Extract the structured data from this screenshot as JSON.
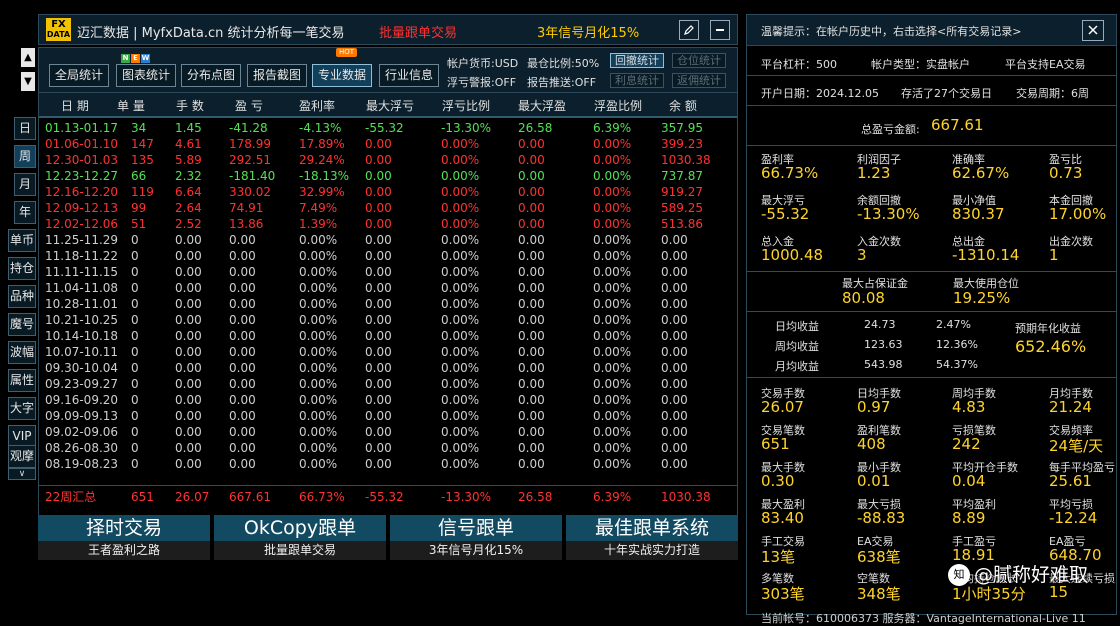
{
  "header": {
    "logo_top": "FX",
    "logo_bottom": "DATA",
    "brand": "迈汇数据 | MyfxData.cn  统计分析每一笔交易",
    "promo_left": "批量跟单交易",
    "promo_right": "3年信号月化15%",
    "edit_icon": "pencil-icon",
    "minimize_icon": "minimize-icon"
  },
  "toolbar": {
    "buttons": [
      "全局统计",
      "图表统计",
      "分布点图",
      "报告截图",
      "专业数据",
      "行业信息"
    ],
    "new_badge": [
      "N",
      "E",
      "W"
    ],
    "hot_badge": "HOT",
    "currency": "帐户货币:USD",
    "max_position": "最仓比例:50%",
    "loss_alert": "浮亏警报:OFF",
    "report_push": "报告推送:OFF",
    "small_buttons": [
      "回撤统计",
      "仓位统计",
      "利息统计",
      "返佣统计"
    ]
  },
  "side": {
    "arrows": [
      "▲",
      "▼"
    ],
    "period_buttons": [
      "日",
      "周",
      "月",
      "年"
    ],
    "tool_buttons": [
      "单币",
      "持仓",
      "品种",
      "魔号",
      "波幅",
      "属性",
      "大字",
      "VIP",
      "观摩"
    ],
    "collapse": "∨"
  },
  "table": {
    "headers": [
      "日 期",
      "单 量",
      "手 数",
      "盈 亏",
      "盈利率",
      "最大浮亏",
      "浮亏比例",
      "最大浮盈",
      "浮盈比例",
      "余 额"
    ],
    "rows": [
      {
        "cls": "green",
        "cells": [
          "01.13-01.17",
          "34",
          "1.45",
          "-41.28",
          "-4.13%",
          "-55.32",
          "-13.30%",
          "26.58",
          "6.39%",
          "357.95"
        ]
      },
      {
        "cls": "red",
        "cells": [
          "01.06-01.10",
          "147",
          "4.61",
          "178.99",
          "17.89%",
          "0.00",
          "0.00%",
          "0.00",
          "0.00%",
          "399.23"
        ]
      },
      {
        "cls": "red",
        "cells": [
          "12.30-01.03",
          "135",
          "5.89",
          "292.51",
          "29.24%",
          "0.00",
          "0.00%",
          "0.00",
          "0.00%",
          "1030.38"
        ]
      },
      {
        "cls": "green",
        "cells": [
          "12.23-12.27",
          "66",
          "2.32",
          "-181.40",
          "-18.13%",
          "0.00",
          "0.00%",
          "0.00",
          "0.00%",
          "737.87"
        ]
      },
      {
        "cls": "red",
        "cells": [
          "12.16-12.20",
          "119",
          "6.64",
          "330.02",
          "32.99%",
          "0.00",
          "0.00%",
          "0.00",
          "0.00%",
          "919.27"
        ]
      },
      {
        "cls": "red",
        "cells": [
          "12.09-12.13",
          "99",
          "2.64",
          "74.91",
          "7.49%",
          "0.00",
          "0.00%",
          "0.00",
          "0.00%",
          "589.25"
        ]
      },
      {
        "cls": "red",
        "cells": [
          "12.02-12.06",
          "51",
          "2.52",
          "13.86",
          "1.39%",
          "0.00",
          "0.00%",
          "0.00",
          "0.00%",
          "513.86"
        ]
      },
      {
        "cls": "gray",
        "cells": [
          "11.25-11.29",
          "0",
          "0.00",
          "0.00",
          "0.00%",
          "0.00",
          "0.00%",
          "0.00",
          "0.00%",
          "0.00"
        ]
      },
      {
        "cls": "gray",
        "cells": [
          "11.18-11.22",
          "0",
          "0.00",
          "0.00",
          "0.00%",
          "0.00",
          "0.00%",
          "0.00",
          "0.00%",
          "0.00"
        ]
      },
      {
        "cls": "gray",
        "cells": [
          "11.11-11.15",
          "0",
          "0.00",
          "0.00",
          "0.00%",
          "0.00",
          "0.00%",
          "0.00",
          "0.00%",
          "0.00"
        ]
      },
      {
        "cls": "gray",
        "cells": [
          "11.04-11.08",
          "0",
          "0.00",
          "0.00",
          "0.00%",
          "0.00",
          "0.00%",
          "0.00",
          "0.00%",
          "0.00"
        ]
      },
      {
        "cls": "gray",
        "cells": [
          "10.28-11.01",
          "0",
          "0.00",
          "0.00",
          "0.00%",
          "0.00",
          "0.00%",
          "0.00",
          "0.00%",
          "0.00"
        ]
      },
      {
        "cls": "gray",
        "cells": [
          "10.21-10.25",
          "0",
          "0.00",
          "0.00",
          "0.00%",
          "0.00",
          "0.00%",
          "0.00",
          "0.00%",
          "0.00"
        ]
      },
      {
        "cls": "gray",
        "cells": [
          "10.14-10.18",
          "0",
          "0.00",
          "0.00",
          "0.00%",
          "0.00",
          "0.00%",
          "0.00",
          "0.00%",
          "0.00"
        ]
      },
      {
        "cls": "gray",
        "cells": [
          "10.07-10.11",
          "0",
          "0.00",
          "0.00",
          "0.00%",
          "0.00",
          "0.00%",
          "0.00",
          "0.00%",
          "0.00"
        ]
      },
      {
        "cls": "gray",
        "cells": [
          "09.30-10.04",
          "0",
          "0.00",
          "0.00",
          "0.00%",
          "0.00",
          "0.00%",
          "0.00",
          "0.00%",
          "0.00"
        ]
      },
      {
        "cls": "gray",
        "cells": [
          "09.23-09.27",
          "0",
          "0.00",
          "0.00",
          "0.00%",
          "0.00",
          "0.00%",
          "0.00",
          "0.00%",
          "0.00"
        ]
      },
      {
        "cls": "gray",
        "cells": [
          "09.16-09.20",
          "0",
          "0.00",
          "0.00",
          "0.00%",
          "0.00",
          "0.00%",
          "0.00",
          "0.00%",
          "0.00"
        ]
      },
      {
        "cls": "gray",
        "cells": [
          "09.09-09.13",
          "0",
          "0.00",
          "0.00",
          "0.00%",
          "0.00",
          "0.00%",
          "0.00",
          "0.00%",
          "0.00"
        ]
      },
      {
        "cls": "gray",
        "cells": [
          "09.02-09.06",
          "0",
          "0.00",
          "0.00",
          "0.00%",
          "0.00",
          "0.00%",
          "0.00",
          "0.00%",
          "0.00"
        ]
      },
      {
        "cls": "gray",
        "cells": [
          "08.26-08.30",
          "0",
          "0.00",
          "0.00",
          "0.00%",
          "0.00",
          "0.00%",
          "0.00",
          "0.00%",
          "0.00"
        ]
      },
      {
        "cls": "gray",
        "cells": [
          "08.19-08.23",
          "0",
          "0.00",
          "0.00",
          "0.00%",
          "0.00",
          "0.00%",
          "0.00",
          "0.00%",
          "0.00"
        ]
      }
    ],
    "summary": [
      "22周汇总",
      "651",
      "26.07",
      "667.61",
      "66.73%",
      "-55.32",
      "-13.30%",
      "26.58",
      "6.39%",
      "1030.38"
    ]
  },
  "banners": [
    {
      "title": "择时交易",
      "sub": "王者盈利之路"
    },
    {
      "title": "OkCopy跟单",
      "sub": "批量跟单交易"
    },
    {
      "title": "信号跟单",
      "sub": "3年信号月化15%"
    },
    {
      "title": "最佳跟单系统",
      "sub": "十年实战实力打造"
    }
  ],
  "panel": {
    "hint": "温馨提示：在帐户历史中，右击选择<所有交易记录>",
    "close_icon": "close-icon",
    "leverage": "平台杠杆：500",
    "account_type": "帐户类型：实盘帐户",
    "ea_support": "平台支持EA交易",
    "open_date": "开户日期：2024.12.05",
    "days": "存活了27个交易日",
    "period": "交易周期：6周",
    "total_label": "总盈亏金额:",
    "total_value": "667.61",
    "stats1": [
      {
        "label": "盈利率",
        "value": "66.73%"
      },
      {
        "label": "利润因子",
        "value": "1.23"
      },
      {
        "label": "准确率",
        "value": "62.67%"
      },
      {
        "label": "盈亏比",
        "value": "0.73"
      },
      {
        "label": "最大浮亏",
        "value": "-55.32"
      },
      {
        "label": "余额回撤",
        "value": "-13.30%"
      },
      {
        "label": "最小净值",
        "value": "830.37"
      },
      {
        "label": "本金回撤",
        "value": "17.00%"
      },
      {
        "label": "总入金",
        "value": "1000.48"
      },
      {
        "label": "入金次数",
        "value": "3"
      },
      {
        "label": "总出金",
        "value": "-1310.14"
      },
      {
        "label": "出金次数",
        "value": "1"
      }
    ],
    "margin": [
      {
        "label": "最大占保证金",
        "value": "80.08"
      },
      {
        "label": "最大使用仓位",
        "value": "19.25%"
      }
    ],
    "returns": [
      {
        "label": "日均收益",
        "amount": "24.73",
        "pct": "2.47%"
      },
      {
        "label": "周均收益",
        "amount": "123.63",
        "pct": "12.36%"
      },
      {
        "label": "月均收益",
        "amount": "543.98",
        "pct": "54.37%"
      }
    ],
    "annual_label": "预期年化收益",
    "annual_value": "652.46%",
    "stats2": [
      {
        "label": "交易手数",
        "value": "26.07"
      },
      {
        "label": "日均手数",
        "value": "0.97"
      },
      {
        "label": "周均手数",
        "value": "4.83"
      },
      {
        "label": "月均手数",
        "value": "21.24"
      },
      {
        "label": "交易笔数",
        "value": "651"
      },
      {
        "label": "盈利笔数",
        "value": "408"
      },
      {
        "label": "亏损笔数",
        "value": "242"
      },
      {
        "label": "交易频率",
        "value": "24笔/天"
      },
      {
        "label": "最大手数",
        "value": "0.30"
      },
      {
        "label": "最小手数",
        "value": "0.01"
      },
      {
        "label": "平均开仓手数",
        "value": "0.04"
      },
      {
        "label": "每手平均盈亏",
        "value": "25.61"
      },
      {
        "label": "最大盈利",
        "value": "83.40"
      },
      {
        "label": "最大亏损",
        "value": "-88.83"
      },
      {
        "label": "平均盈利",
        "value": "8.89"
      },
      {
        "label": "平均亏损",
        "value": "-12.24"
      },
      {
        "label": "手工交易",
        "value": "13笔"
      },
      {
        "label": "EA交易",
        "value": "638笔"
      },
      {
        "label": "手工盈亏",
        "value": "18.91"
      },
      {
        "label": "EA盈亏",
        "value": "648.70"
      },
      {
        "label": "多笔数",
        "value": "303笔"
      },
      {
        "label": "空笔数",
        "value": "348笔"
      },
      {
        "label": "平均持仓时长",
        "value": "1小时35分"
      },
      {
        "label": "最大连续亏损",
        "value": "15"
      }
    ],
    "footer": "当前帐号：610006373   服务器：VantageInternational-Live 11"
  },
  "watermark": "@腻称好难取",
  "watermark_icon": "知"
}
